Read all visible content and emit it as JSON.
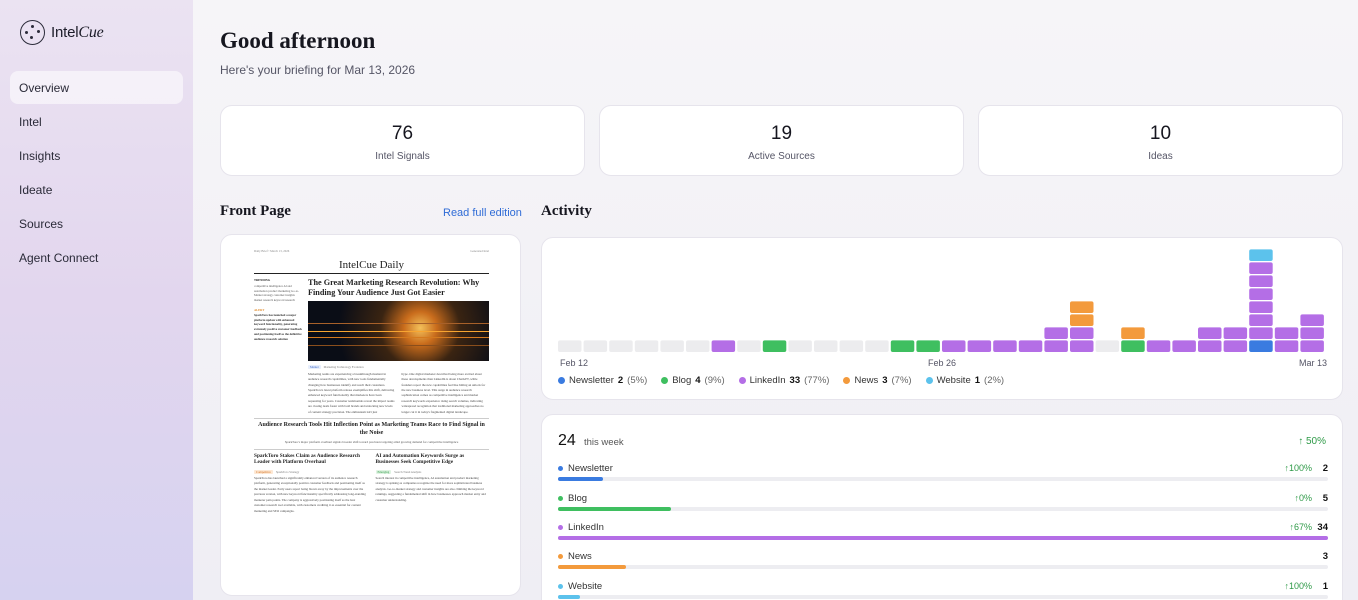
{
  "brand": {
    "name_plain": "Intel",
    "name_italic": "Cue"
  },
  "nav": [
    {
      "label": "Overview",
      "active": true
    },
    {
      "label": "Intel",
      "active": false
    },
    {
      "label": "Insights",
      "active": false
    },
    {
      "label": "Ideate",
      "active": false
    },
    {
      "label": "Sources",
      "active": false
    },
    {
      "label": "Agent Connect",
      "active": false
    }
  ],
  "header": {
    "greeting": "Good afternoon",
    "subtitle": "Here's your briefing for Mar 13, 2026"
  },
  "stats": [
    {
      "value": "76",
      "label": "Intel Signals"
    },
    {
      "value": "19",
      "label": "Active Sources"
    },
    {
      "value": "10",
      "label": "Ideas"
    }
  ],
  "front_page": {
    "title": "Front Page",
    "link": "Read full edition",
    "paper": {
      "meta_left": "Daily Brief • March 13, 2026",
      "meta_right": "Generated Intel",
      "masthead": "IntelCue Daily",
      "trending_label": "TRENDING",
      "trending_text": "competitive intelligence AI and automation product marketing Go-to-Market strategy customer insights market research keyword research",
      "alert_label": "ALERT",
      "alert_text": "SparkToro has launched a major platform update with enhanced keyword functionality, generating extremely positive customer feedback and positioning itself as the definitive audience research solution",
      "lead_headline": "The Great Marketing Research Revolution: Why Finding Your Audience Just Got Easier",
      "lead_tag": "Market",
      "lead_tag_note": "Marketing Technology Evolution",
      "lead_col1": "Marketing teams are experiencing a breakthrough moment in audience research capabilities, with new tools fundamentally changing how businesses identify and reach their customers. SparkToro's latest platform release exemplifies this shift, delivering enhanced keyword functionality that marketers have been requesting for years. Customer testimonials reveal the impact teams are closing deals faster with bold brands and unlocking new levels of content strategy precision. The enthusiasm isn't just",
      "lead_col2": "hype. One digital marketer described being more excited about these developments than LinkedIn is about ChatGPT, while founders report the new capabilities feel like hitting an unlock for the new business level. This surge in audience research sophistication comes as competitive intelligence and market research keywords experience rising search volumes, indicating widespread recognition that traditional marketing approaches no longer cut it in today's fragmented digital landscape.",
      "second_headline": "Audience Research Tools Hit Inflection Point as Marketing Teams Race to Find Signal in the Noise",
      "second_sub": "SparkToro's major platform overhaul signals broader shift toward precision targeting amid growing demand for competitive intelligence",
      "bottom_left_headline": "SparkToro Stakes Claim as Audience Research Leader with Platform Overhaul",
      "bottom_left_tag": "Competitive",
      "bottom_left_tag_note": "SparkToro Strategy",
      "bottom_left_text": "SparkToro has launched a significantly enhanced version of its audience research platform, generating exceptionally positive customer feedback and positioning itself as the market leader. Early users report being blown away by the improvements over the previous version, with new keyword functionality specifically addressing long-standing marketer pain points. The company is aggressively positioning itself as the best customer research tool available, with customers crediting it as essential for content marketing and SEO campaigns.",
      "bottom_right_headline": "AI and Automation Keywords Surge as Businesses Seek Competitive Edge",
      "bottom_right_tag": "Emerging",
      "bottom_right_tag_note": "Search Trend Analysis",
      "bottom_right_text": "Search interest in competitive intelligence, AI automation and product marketing strategy is spiking as companies recognize the need for more sophisticated business analysis. Go-to-market strategy and customer insights are also climbing the keyword rankings, suggesting a fundamental shift in how businesses approach market entry and customer understanding."
    }
  },
  "activity": {
    "title": "Activity",
    "date_labels": [
      "Feb 12",
      "Feb 26",
      "Mar 13"
    ],
    "colors": {
      "Newsletter": "#3a7be0",
      "Blog": "#3fbf60",
      "LinkedIn": "#b46ee6",
      "News": "#f39a3c",
      "Website": "#5cc2ec",
      "empty": "#ececee"
    },
    "chart_data": {
      "type": "bar",
      "stacked": true,
      "x": [
        "Feb 12",
        "Feb 13",
        "Feb 14",
        "Feb 15",
        "Feb 16",
        "Feb 17",
        "Feb 18",
        "Feb 19",
        "Feb 20",
        "Feb 21",
        "Feb 22",
        "Feb 23",
        "Feb 24",
        "Feb 25",
        "Feb 26",
        "Feb 27",
        "Feb 28",
        "Mar 1",
        "Mar 2",
        "Mar 3",
        "Mar 4",
        "Mar 5",
        "Mar 6",
        "Mar 7",
        "Mar 8",
        "Mar 9",
        "Mar 10",
        "Mar 11",
        "Mar 12",
        "Mar 13"
      ],
      "series": [
        {
          "name": "Newsletter",
          "values": [
            0,
            0,
            0,
            0,
            0,
            0,
            0,
            0,
            0,
            0,
            0,
            0,
            0,
            0,
            0,
            0,
            0,
            0,
            0,
            0,
            0,
            0,
            0,
            0,
            0,
            0,
            0,
            1,
            0,
            0
          ]
        },
        {
          "name": "Blog",
          "values": [
            0,
            0,
            0,
            0,
            0,
            0,
            0,
            0,
            1,
            0,
            0,
            0,
            0,
            1,
            1,
            0,
            0,
            0,
            0,
            0,
            0,
            0,
            1,
            0,
            0,
            0,
            0,
            0,
            0,
            0
          ]
        },
        {
          "name": "LinkedIn",
          "values": [
            0,
            0,
            0,
            0,
            0,
            0,
            1,
            0,
            0,
            0,
            0,
            0,
            0,
            0,
            0,
            1,
            1,
            1,
            1,
            2,
            2,
            0,
            0,
            1,
            1,
            2,
            2,
            6,
            2,
            3
          ]
        },
        {
          "name": "News",
          "values": [
            0,
            0,
            0,
            0,
            0,
            0,
            0,
            0,
            0,
            0,
            0,
            0,
            0,
            0,
            0,
            0,
            0,
            0,
            0,
            0,
            2,
            0,
            1,
            0,
            0,
            0,
            0,
            0,
            0,
            0
          ]
        },
        {
          "name": "Website",
          "values": [
            0,
            0,
            0,
            0,
            0,
            0,
            0,
            0,
            0,
            0,
            0,
            0,
            0,
            0,
            0,
            0,
            0,
            0,
            0,
            0,
            0,
            0,
            0,
            0,
            0,
            0,
            0,
            1,
            0,
            0
          ]
        }
      ]
    },
    "legend": [
      {
        "name": "Newsletter",
        "count": "2",
        "pct": "(5%)",
        "color": "#3a7be0"
      },
      {
        "name": "Blog",
        "count": "4",
        "pct": "(9%)",
        "color": "#3fbf60"
      },
      {
        "name": "LinkedIn",
        "count": "33",
        "pct": "(77%)",
        "color": "#b46ee6"
      },
      {
        "name": "News",
        "count": "3",
        "pct": "(7%)",
        "color": "#f39a3c"
      },
      {
        "name": "Website",
        "count": "1",
        "pct": "(2%)",
        "color": "#5cc2ec"
      }
    ]
  },
  "week": {
    "count": "24",
    "label": "this week",
    "change": "50%",
    "rows": [
      {
        "name": "Newsletter",
        "change": "100%",
        "count": "2",
        "color": "#3a7be0",
        "fraction": 0.059
      },
      {
        "name": "Blog",
        "change": "0%",
        "count": "5",
        "color": "#3fbf60",
        "fraction": 0.147
      },
      {
        "name": "LinkedIn",
        "change": "67%",
        "count": "34",
        "color": "#b46ee6",
        "fraction": 1.0
      },
      {
        "name": "News",
        "change": "",
        "count": "3",
        "color": "#f39a3c",
        "fraction": 0.088
      },
      {
        "name": "Website",
        "change": "100%",
        "count": "1",
        "color": "#5cc2ec",
        "fraction": 0.029
      }
    ]
  }
}
